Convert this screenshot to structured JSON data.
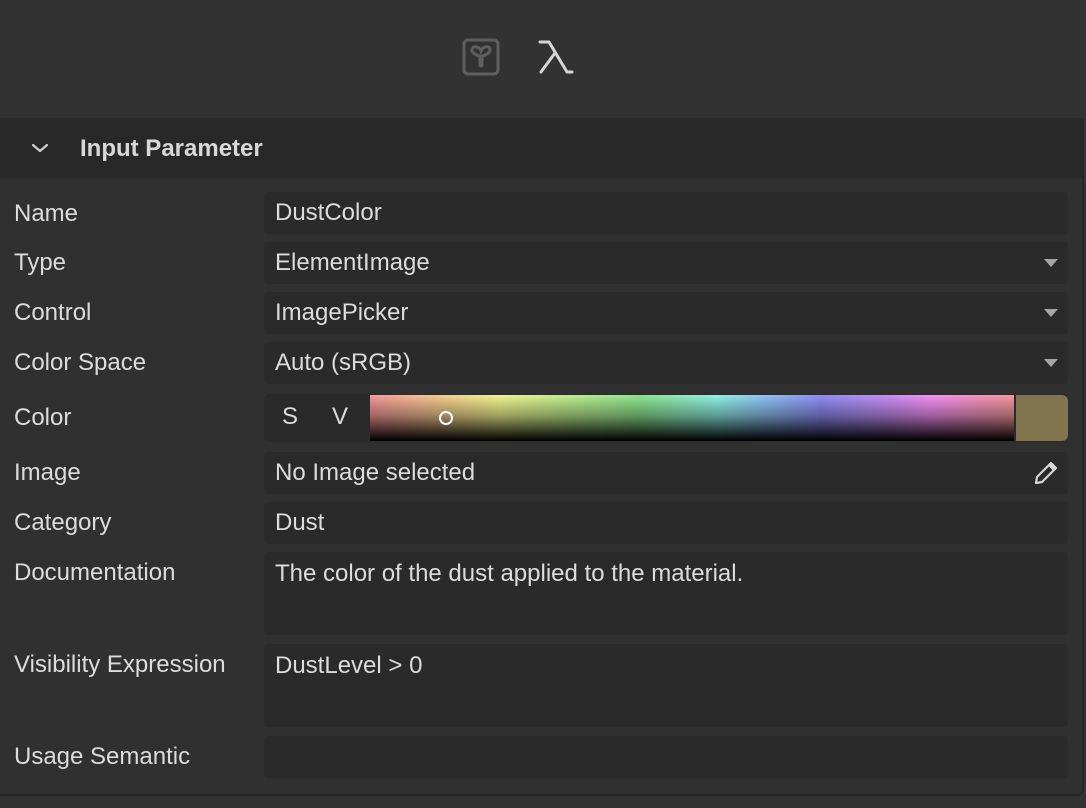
{
  "toolbar": {
    "icons": [
      {
        "name": "node-graph-icon",
        "active": false
      },
      {
        "name": "lambda-icon",
        "glyph": "λ",
        "active": true
      }
    ]
  },
  "panel": {
    "title": "Input Parameter",
    "expanded": true
  },
  "fields": {
    "name": {
      "label": "Name",
      "value": "DustColor"
    },
    "type": {
      "label": "Type",
      "value": "ElementImage"
    },
    "control": {
      "label": "Control",
      "value": "ImagePicker"
    },
    "color_space": {
      "label": "Color Space",
      "value": "Auto (sRGB)"
    },
    "color": {
      "label": "Color",
      "s_label": "S",
      "v_label": "V",
      "swatch_color": "#81744f"
    },
    "image": {
      "label": "Image",
      "value": "No Image selected"
    },
    "category": {
      "label": "Category",
      "value": "Dust"
    },
    "documentation": {
      "label": "Documentation",
      "value": "The color of the dust applied to the material."
    },
    "visibility_expression": {
      "label": "Visibility Expression",
      "value": "DustLevel > 0"
    },
    "usage_semantic": {
      "label": "Usage Semantic",
      "value": ""
    }
  }
}
